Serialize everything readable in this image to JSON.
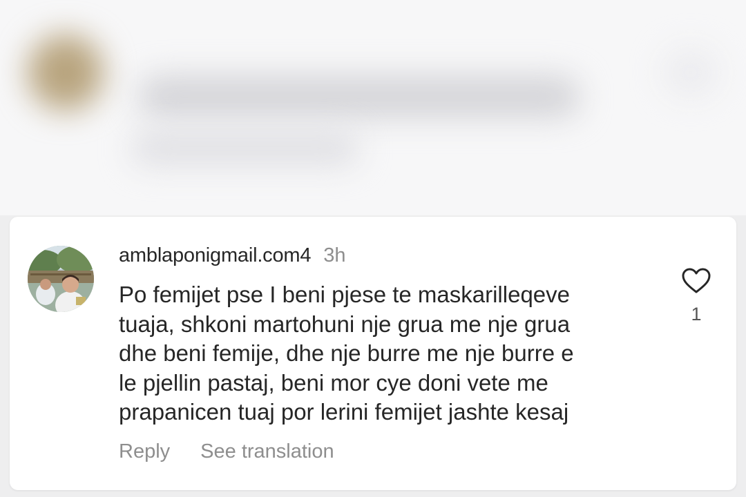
{
  "comment": {
    "username": "amblaponigmail.com4",
    "time": "3h",
    "text_lines": [
      "Po femijet pse I beni pjese te maskarilleqeve",
      "tuaja, shkoni martohuni nje grua me nje grua",
      "dhe beni femije, dhe nje burre me nje burre e",
      "le pjellin pastaj, beni mor cye doni vete me",
      "prapanicen tuaj por lerini femijet jashte kesaj"
    ],
    "like_count": "1",
    "actions": {
      "reply": "Reply",
      "see_translation": "See translation"
    },
    "icons": {
      "like": "heart-outline-icon",
      "avatar": "user-avatar"
    }
  },
  "colors": {
    "text_primary": "#262626",
    "text_secondary": "#8e8e8e",
    "card_background": "#ffffff",
    "page_background": "#eeeeef"
  }
}
